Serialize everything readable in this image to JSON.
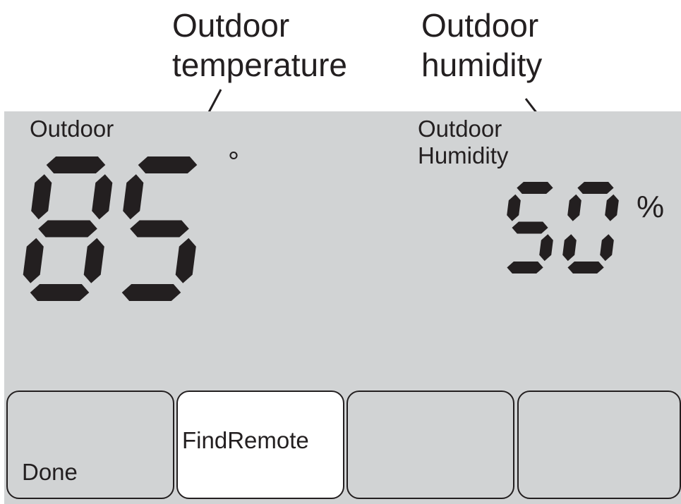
{
  "callouts": {
    "temperature": "Outdoor\ntemperature",
    "humidity": "Outdoor\nhumidity"
  },
  "display": {
    "temperature_label": "Outdoor",
    "temperature_value": "85",
    "temperature_unit": "°",
    "humidity_label": "Outdoor\nHumidity",
    "humidity_value": "50",
    "humidity_unit": "%"
  },
  "softkeys": [
    {
      "label": "Done",
      "active": false
    },
    {
      "label": "FindRemote",
      "active": true
    },
    {
      "label": "",
      "active": false
    },
    {
      "label": "",
      "active": false
    }
  ],
  "colors": {
    "screen_background": "#d1d3d4",
    "segment": "#231f20",
    "active_key_background": "#ffffff"
  }
}
